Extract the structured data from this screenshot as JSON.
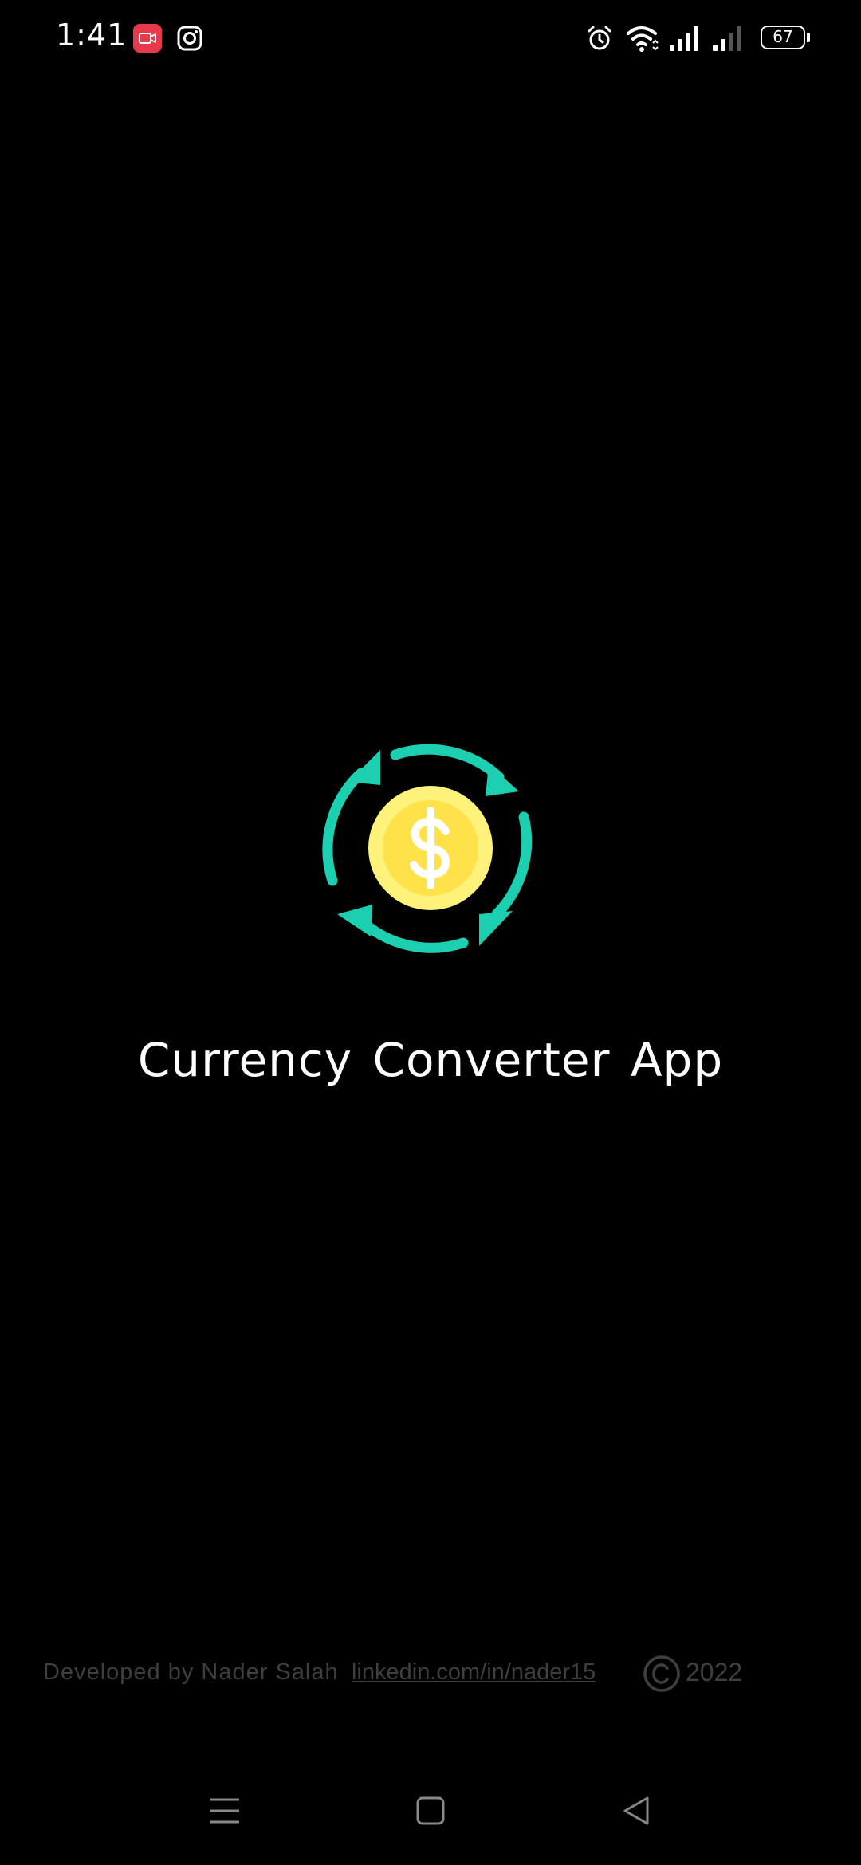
{
  "status_bar": {
    "time": "1:41",
    "battery_level": "67",
    "icons": [
      "screen-recorder-icon",
      "instagram-icon",
      "alarm-icon",
      "wifi-icon",
      "signal-icon",
      "signal-icon"
    ]
  },
  "splash": {
    "logo_icon": "currency-exchange-icon",
    "title": "Currency Converter App"
  },
  "footer": {
    "developer": "Developed by Nader Salah",
    "link": "linkedin.com/in/nader15",
    "copyright_icon": "copyright-icon",
    "year": "2022"
  },
  "nav_bar": {
    "icons": [
      "menu-icon",
      "home-icon",
      "back-icon"
    ]
  },
  "colors": {
    "background": "#000000",
    "accent_teal": "#1ccfb0",
    "coin_outer": "#fff27a",
    "coin_inner": "#ffe14a",
    "footer_text": "#3f3f3f"
  }
}
